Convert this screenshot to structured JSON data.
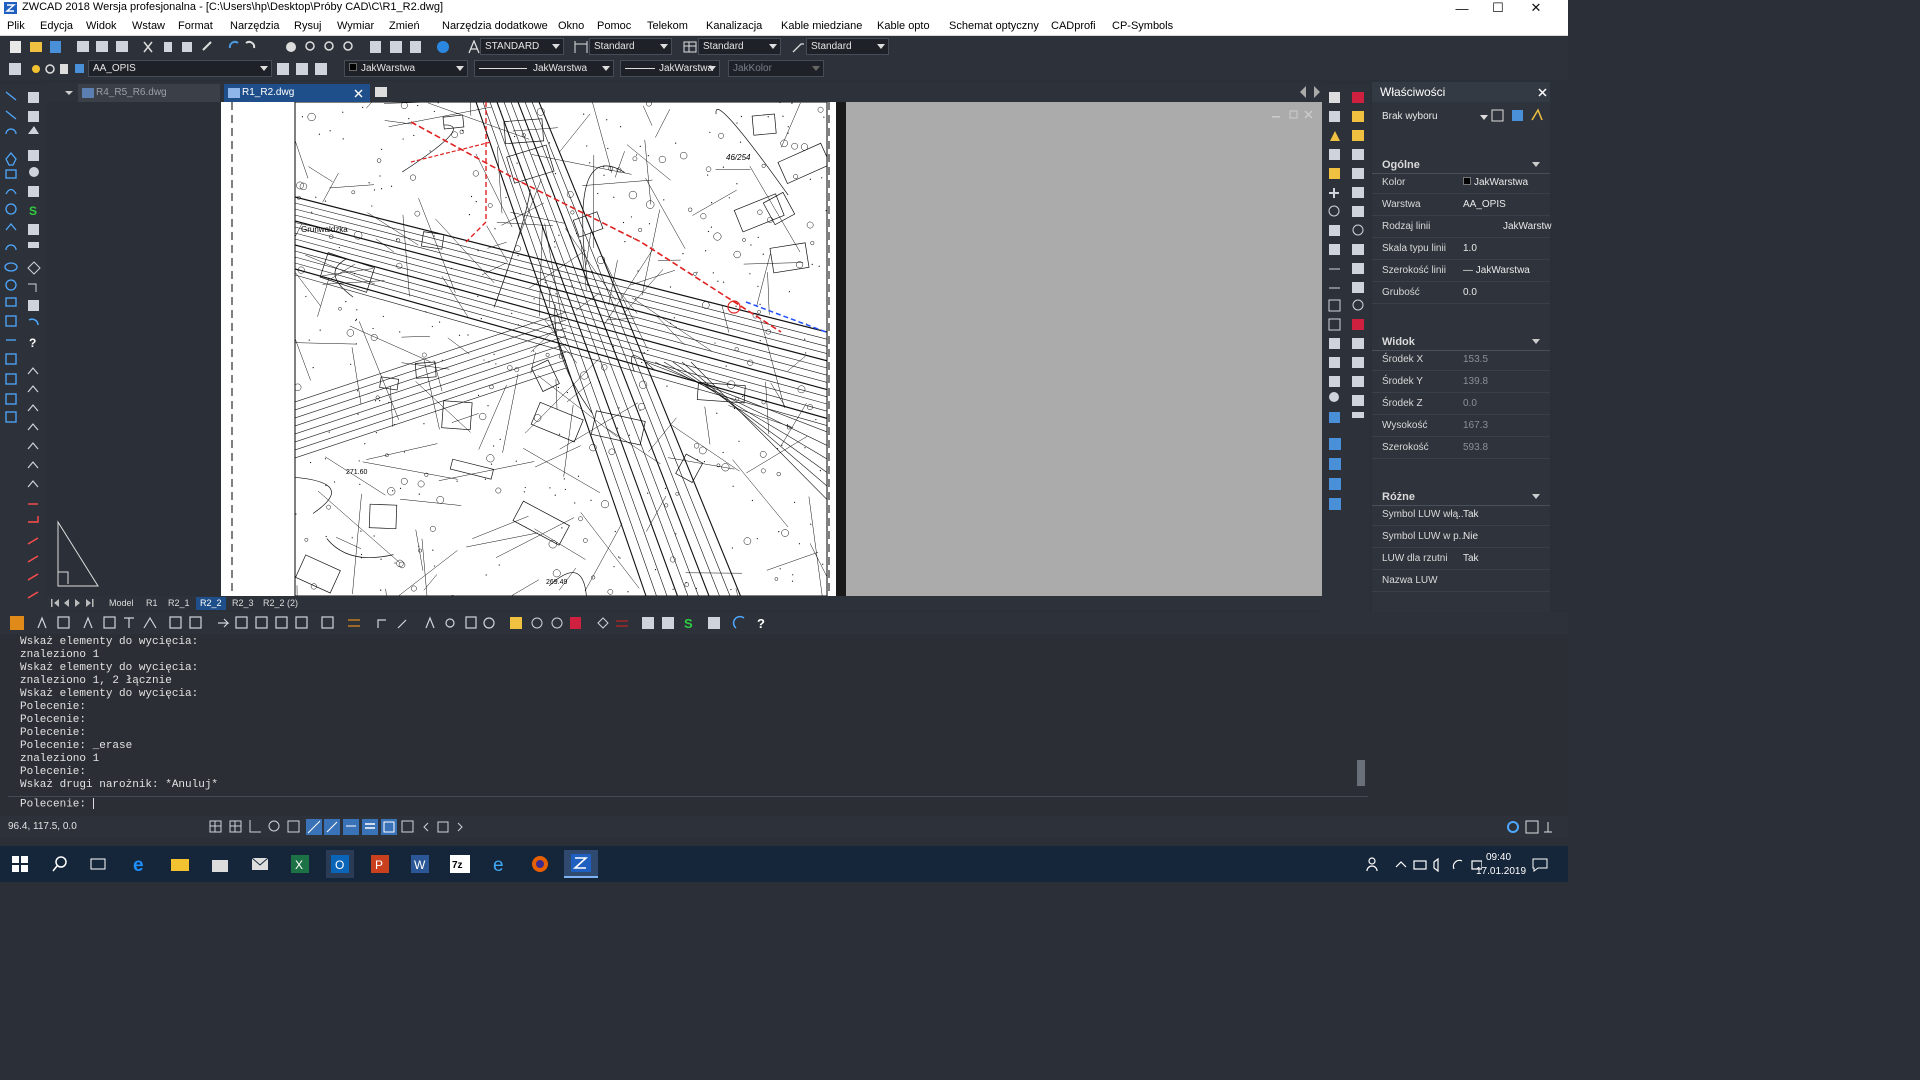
{
  "window": {
    "title": "ZWCAD 2018 Wersja profesjonalna - [C:\\Users\\hp\\Desktop\\Próby CAD\\C\\R1_R2.dwg]",
    "minimize": "—",
    "maximize": "☐",
    "close": "✕"
  },
  "menu": [
    "Plik",
    "Edycja",
    "Widok",
    "Wstaw",
    "Format",
    "Narzędzia",
    "Rysuj",
    "Wymiar",
    "Zmień",
    "Narzędzia dodatkowe",
    "Okno",
    "Pomoc",
    "Telekom",
    "Kanalizacja",
    "Kable miedziane",
    "Kable opto",
    "Schemat optyczny",
    "CADprofi",
    "CP-Symbols"
  ],
  "toolbar": {
    "text_style": "STANDARD",
    "dim_style": "Standard",
    "table_style": "Standard",
    "mleader_style": "Standard",
    "layer": "AA_OPIS",
    "color": "JakWarstwa",
    "linetype": "JakWarstwa",
    "lineweight": "JakWarstwa",
    "plotstyle": "JakKolor"
  },
  "doc_tabs": [
    {
      "label": "R4_R5_R6.dwg",
      "active": false
    },
    {
      "label": "R1_R2.dwg",
      "active": true
    }
  ],
  "layout_tabs": [
    "Model",
    "R1",
    "R2_1",
    "R2_2",
    "R2_3",
    "R2_2 (2)"
  ],
  "active_layout": "R2_2",
  "map_labels": {
    "street": "Grunwaldzka",
    "parcel": "46/254",
    "elev1": "271.60",
    "elev2": "269.49"
  },
  "properties": {
    "title": "Właściwości",
    "selection": "Brak wyboru",
    "sections": [
      {
        "name": "Ogólne",
        "rows": [
          {
            "k": "Kolor",
            "v": "JakWarstwa"
          },
          {
            "k": "Warstwa",
            "v": "AA_OPIS"
          },
          {
            "k": "Rodzaj linii",
            "v": "JakWarstw"
          },
          {
            "k": "Skala typu linii",
            "v": "1.0"
          },
          {
            "k": "Szerokość linii",
            "v": "— JakWarstwa"
          },
          {
            "k": "Grubość",
            "v": "0.0"
          }
        ]
      },
      {
        "name": "Widok",
        "rows": [
          {
            "k": "Środek X",
            "v": "153.5"
          },
          {
            "k": "Środek Y",
            "v": "139.8"
          },
          {
            "k": "Środek Z",
            "v": "0.0"
          },
          {
            "k": "Wysokość",
            "v": "167.3"
          },
          {
            "k": "Szerokość",
            "v": "593.8"
          }
        ]
      },
      {
        "name": "Różne",
        "rows": [
          {
            "k": "Symbol LUW włą...",
            "v": "Tak"
          },
          {
            "k": "Symbol LUW w p...",
            "v": "Nie"
          },
          {
            "k": "LUW dla rzutni",
            "v": "Tak"
          },
          {
            "k": "Nazwa LUW",
            "v": ""
          }
        ]
      }
    ]
  },
  "command": {
    "history": [
      "Wskaż elementy do wycięcia:",
      "znaleziono 1",
      "Wskaż elementy do wycięcia:",
      "znaleziono 1, 2 łącznie",
      "Wskaż elementy do wycięcia:",
      "Polecenie:",
      "Polecenie:",
      "Polecenie:",
      "Polecenie: _erase",
      "znaleziono 1",
      "Polecenie:",
      "Wskaż drugi narożnik: *Anuluj*"
    ],
    "prompt": "Polecenie:"
  },
  "status": {
    "coords": "96.4, 117.5, 0.0"
  },
  "taskbar": {
    "time": "09:40",
    "date": "17.01.2019"
  },
  "colors": {
    "accent": "#1e90ff",
    "red_boundary": "#e02020",
    "dark_bg": "#2d323a"
  }
}
